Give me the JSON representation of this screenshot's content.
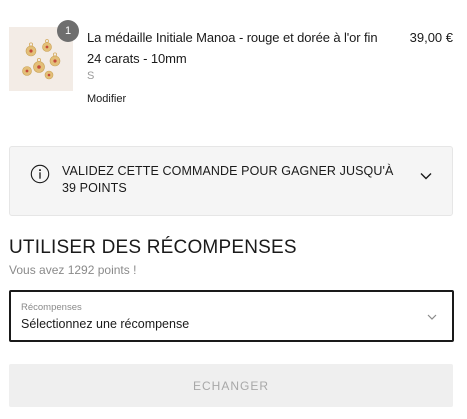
{
  "product": {
    "quantity": "1",
    "title": "La médaille Initiale Manoa - rouge et dorée à l'or fin 24 carats - 10mm",
    "variant": "S",
    "edit_label": "Modifier",
    "price": "39,00 €"
  },
  "points_banner": {
    "text": "VALIDEZ CETTE COMMANDE POUR GAGNER JUSQU'À 39 POINTS",
    "icon": "info-icon",
    "toggle_icon": "chevron-down-icon"
  },
  "rewards": {
    "title": "UTILISER DES RÉCOMPENSES",
    "subtitle": "Vous avez 1292 points !",
    "select": {
      "label": "Récompenses",
      "value": "Sélectionnez une récompense",
      "icon": "chevron-down-icon"
    },
    "exchange_button": "ECHANGER"
  },
  "colors": {
    "text": "#1a1a1a",
    "muted": "#8a8a8a",
    "banner_bg": "#f5f5f5",
    "button_bg": "#efefef",
    "button_text": "#a8a8a8",
    "badge_bg": "#6e6e6e"
  }
}
